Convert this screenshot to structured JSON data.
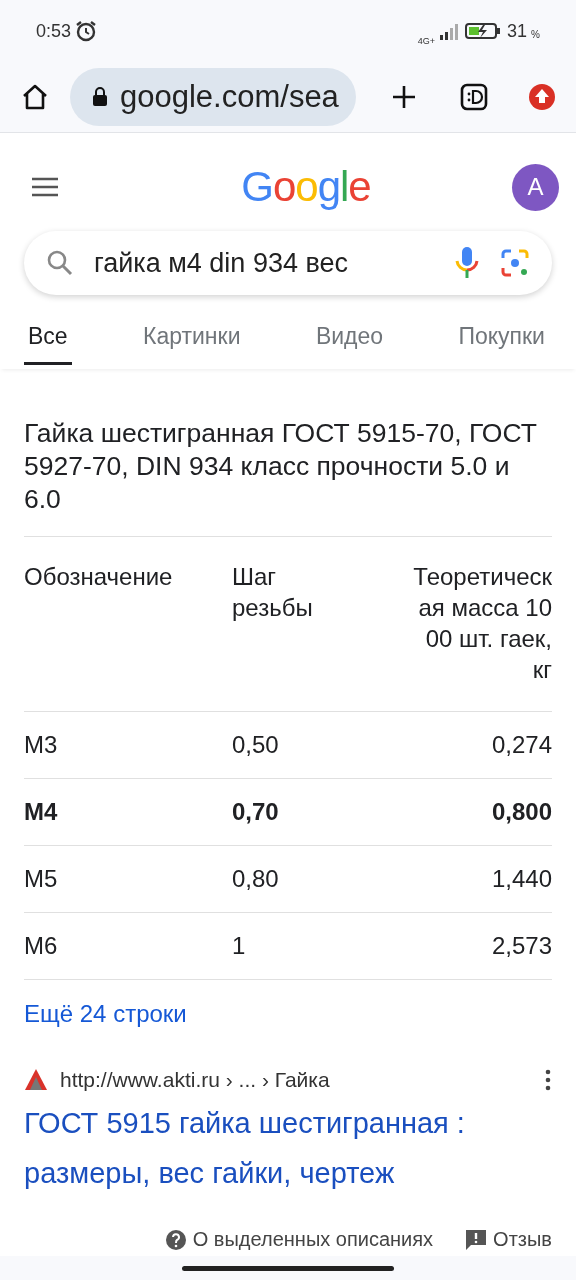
{
  "status_bar": {
    "time": "0:53",
    "network": "4G+",
    "battery": "31",
    "battery_unit": "%"
  },
  "browser": {
    "url": "google.com/sea"
  },
  "header": {
    "logo": "Google",
    "avatar": "A"
  },
  "search": {
    "value": "гайка м4 din 934 вес"
  },
  "tabs": [
    {
      "label": "Все",
      "selected": true
    },
    {
      "label": "Картинки",
      "selected": false
    },
    {
      "label": "Видео",
      "selected": false
    },
    {
      "label": "Покупки",
      "selected": false
    }
  ],
  "snippet": {
    "title": "Гайка шестигранная ГОСТ 5915-70, ГОСТ 5927-70, DIN 934 класс прочности 5.0 и 6.0",
    "table": {
      "columns": [
        "Обозначение",
        "Шаг резьбы",
        "Теоретическая масса 1000 шт. гаек, кг"
      ],
      "rows": [
        {
          "cells": [
            "М3",
            "0,50",
            "0,274"
          ],
          "highlighted": false
        },
        {
          "cells": [
            "М4",
            "0,70",
            "0,800"
          ],
          "highlighted": true
        },
        {
          "cells": [
            "М5",
            "0,80",
            "1,440"
          ],
          "highlighted": false
        },
        {
          "cells": [
            "М6",
            "1",
            "2,573"
          ],
          "highlighted": false
        }
      ]
    },
    "more_link": "Ещё 24 строки"
  },
  "result": {
    "url": "http://www.akti.ru › ... › Гайка",
    "title": "ГОСТ 5915 гайка шестигранная : размеры, вес гайки, чертеж"
  },
  "footer": {
    "about": "О выделенных описаниях",
    "feedback": "Отзыв"
  }
}
